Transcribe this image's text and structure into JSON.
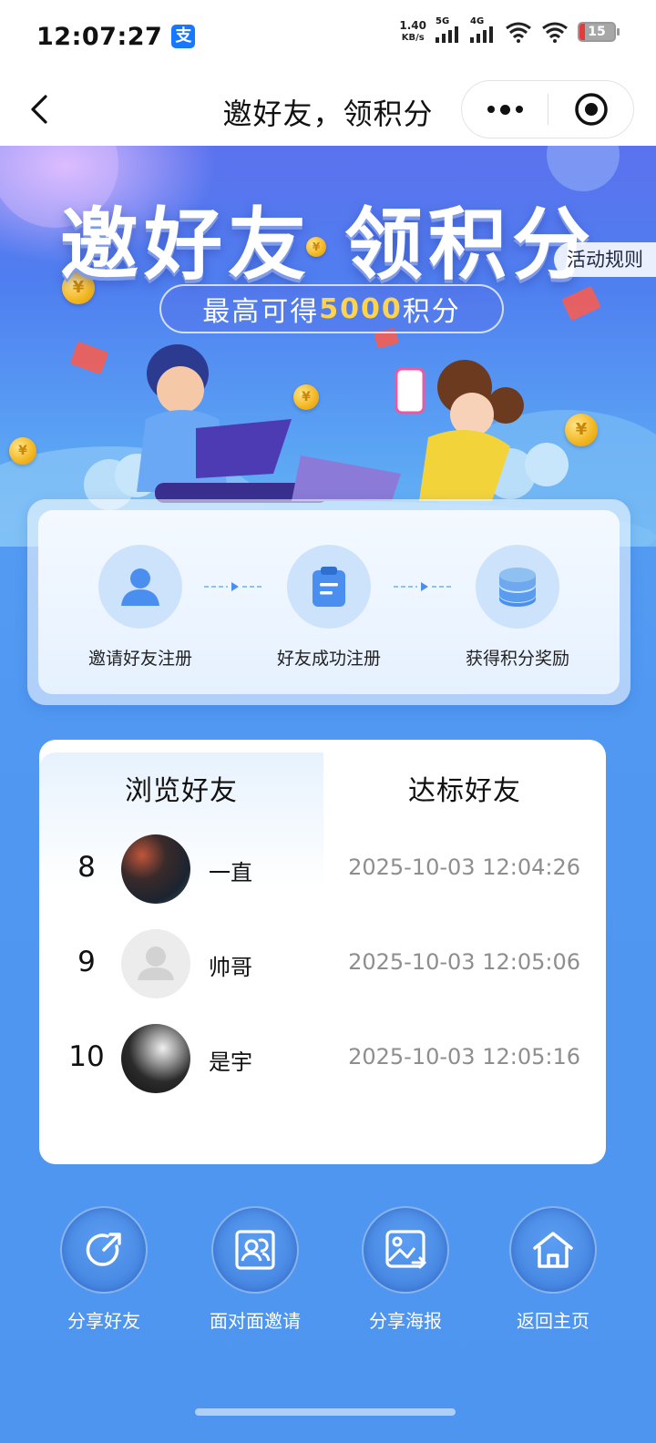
{
  "status_bar": {
    "time": "12:07:27",
    "alipay_badge": "支",
    "net_speed_value": "1.40",
    "net_speed_unit": "KB/s",
    "sim1_label": "5G",
    "sim2_label": "4G",
    "battery": "15"
  },
  "nav": {
    "title": "邀好友，领积分"
  },
  "banner": {
    "title": "邀好友 领积分",
    "subtitle_prefix": "最高可得",
    "subtitle_highlight": "5000",
    "subtitle_suffix": "积分",
    "rules_label": "活动规则"
  },
  "steps": [
    {
      "label": "邀请好友注册",
      "icon": "user-icon"
    },
    {
      "label": "好友成功注册",
      "icon": "clipboard-icon"
    },
    {
      "label": "获得积分奖励",
      "icon": "coins-stack-icon"
    }
  ],
  "tabs": [
    {
      "label": "浏览好友",
      "active": false
    },
    {
      "label": "达标好友",
      "active": true
    }
  ],
  "friends": [
    {
      "rank": "8",
      "name": "一直",
      "time": "2025-10-03 12:04:26",
      "avatar": "photo-night-street"
    },
    {
      "rank": "9",
      "name": "帅哥",
      "time": "2025-10-03 12:05:06",
      "avatar": "default-avatar"
    },
    {
      "rank": "10",
      "name": "是宇",
      "time": "2025-10-03 12:05:16",
      "avatar": "photo-bw-portrait"
    }
  ],
  "actions": [
    {
      "label": "分享好友",
      "icon": "share-arrow-icon"
    },
    {
      "label": "面对面邀请",
      "icon": "face-to-face-icon"
    },
    {
      "label": "分享海报",
      "icon": "poster-share-icon"
    },
    {
      "label": "返回主页",
      "icon": "home-icon"
    }
  ],
  "colors": {
    "primary_blue": "#4f97f1",
    "highlight_yellow": "#ffd34a",
    "step_circle": "#cde3fb",
    "icon_blue": "#4a8ff0"
  }
}
